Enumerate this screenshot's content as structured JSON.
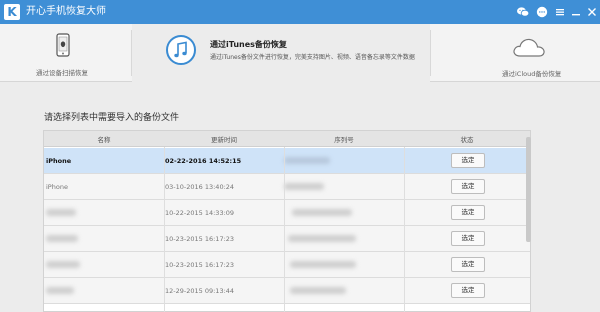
{
  "window": {
    "title": "开心手机恢复大师",
    "logo_letter": "K"
  },
  "topnav": {
    "device": {
      "label": "通过设备扫描恢复"
    },
    "itunes": {
      "title": "通过iTunes备份恢复",
      "description": "通过iTunes备份文件进行恢复，完美支持图片、视频、语音备忘录等文件数据"
    },
    "cloud": {
      "label": "通过iCloud备份恢复"
    }
  },
  "content": {
    "title": "请选择列表中需要导入的备份文件",
    "table": {
      "headers": [
        "名称",
        "更新时间",
        "序列号",
        "状态"
      ],
      "rows": [
        {
          "name": "iPhone",
          "time": "02-22-2016 14:52:15",
          "button": "选定",
          "selected": true
        },
        {
          "name": "iPhone",
          "time": "03-10-2016 13:40:24",
          "button": "选定",
          "selected": false
        },
        {
          "name": "",
          "time": "10-22-2015 14:33:09",
          "button": "选定",
          "selected": false
        },
        {
          "name": "",
          "time": "10-23-2015 16:17:23",
          "button": "选定",
          "selected": false
        },
        {
          "name": "",
          "time": "10-23-2015 16:17:23",
          "button": "选定",
          "selected": false
        },
        {
          "name": "",
          "time": "12-29-2015 09:13:44",
          "button": "选定",
          "selected": false
        }
      ]
    }
  },
  "colors": {
    "titlebar": "#3f8fd6",
    "selected_row": "#cfe3f8",
    "accent_icon": "#3a8bd2"
  },
  "icons": [
    "app-logo",
    "wechat-icon",
    "feedback-icon",
    "menu-icon",
    "minimize-icon",
    "close-icon",
    "device-phone-icon",
    "itunes-music-icon",
    "icloud-icon"
  ]
}
